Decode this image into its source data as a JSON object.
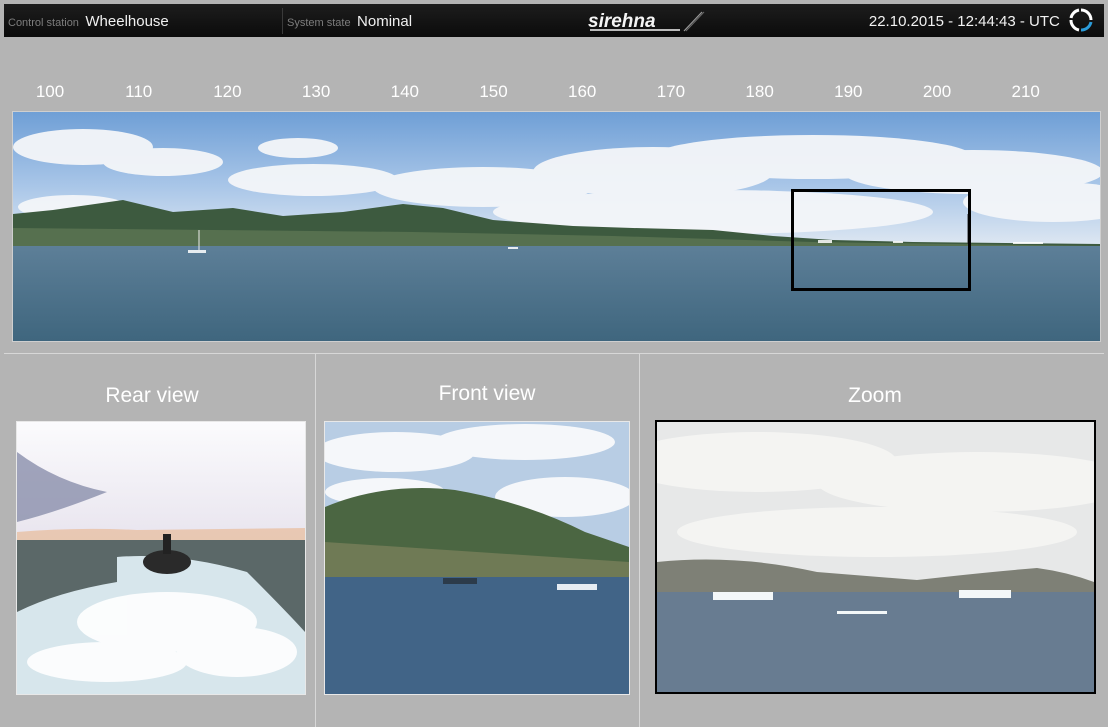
{
  "topbar": {
    "control_station_label": "Control station",
    "control_station_value": "Wheelhouse",
    "system_state_label": "System state",
    "system_state_value": "Nominal",
    "brand": "sirehna",
    "datetime": "22.10.2015 - 12:44:43 - UTC"
  },
  "scale": {
    "ticks": [
      "100",
      "110",
      "120",
      "130",
      "140",
      "150",
      "160",
      "170",
      "180",
      "190",
      "200",
      "210"
    ]
  },
  "views": {
    "rear_title": "Rear view",
    "front_title": "Front view",
    "zoom_title": "Zoom"
  },
  "icons": {
    "sync": "sync-icon",
    "logo": "sirehna-logo"
  },
  "colors": {
    "background": "#b4b4b4",
    "topbar": "#111111",
    "sync_accent": "#2b9bd8"
  }
}
